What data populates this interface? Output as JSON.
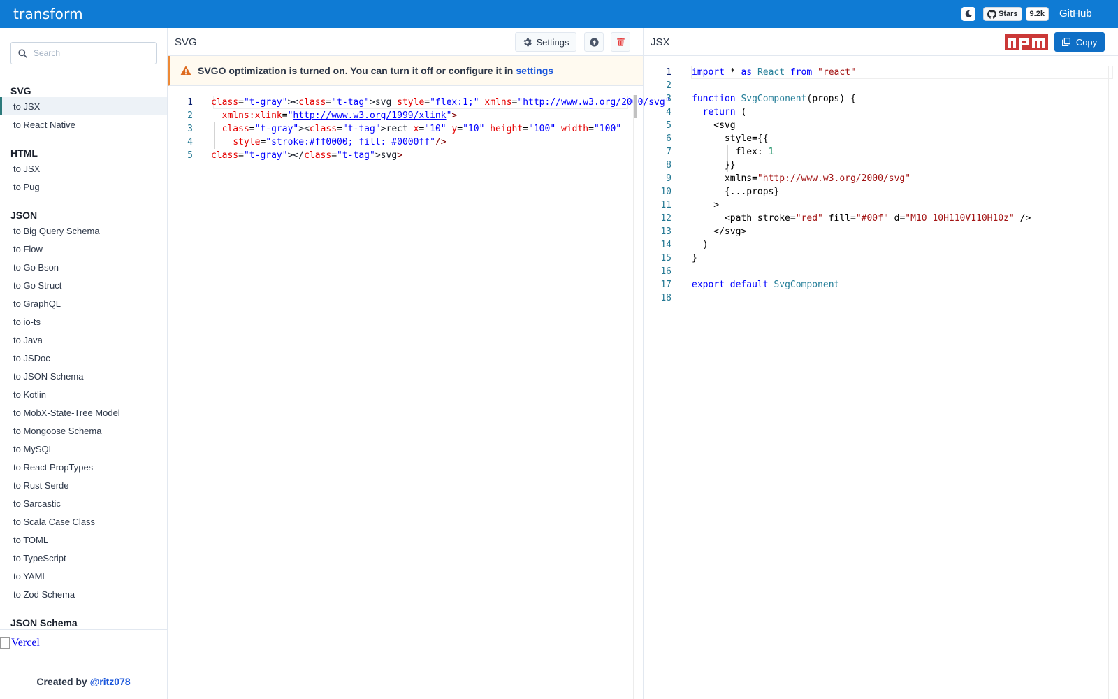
{
  "header": {
    "logo": "transform",
    "stars_label": "Stars",
    "stars_count": "9.2k",
    "github_link": "GitHub"
  },
  "sidebar": {
    "search_placeholder": "Search",
    "groups": [
      {
        "title": "SVG",
        "items": [
          "to JSX",
          "to React Native"
        ]
      },
      {
        "title": "HTML",
        "items": [
          "to JSX",
          "to Pug"
        ]
      },
      {
        "title": "JSON",
        "items": [
          "to Big Query Schema",
          "to Flow",
          "to Go Bson",
          "to Go Struct",
          "to GraphQL",
          "to io-ts",
          "to Java",
          "to JSDoc",
          "to JSON Schema",
          "to Kotlin",
          "to MobX-State-Tree Model",
          "to Mongoose Schema",
          "to MySQL",
          "to React PropTypes",
          "to Rust Serde",
          "to Sarcastic",
          "to Scala Case Class",
          "to TOML",
          "to TypeScript",
          "to YAML",
          "to Zod Schema"
        ]
      },
      {
        "title": "JSON Schema",
        "items": []
      }
    ],
    "vercel_alt": "Vercel",
    "created_by": "Created by",
    "author": "@ritz078"
  },
  "left_panel": {
    "title": "SVG",
    "settings_label": "Settings",
    "alert_text": "SVGO optimization is turned on. You can turn it off or configure it in",
    "alert_link": "settings",
    "line_numbers": [
      "1",
      "2",
      "3",
      "4",
      "5"
    ],
    "code_lines": [
      "<svg style=\"flex:1;\" xmlns=\"http://www.w3.org/2000/svg\"",
      "  xmlns:xlink=\"http://www.w3.org/1999/xlink\">",
      "  <rect x=\"10\" y=\"10\" height=\"100\" width=\"100\"",
      "    style=\"stroke:#ff0000; fill: #0000ff\"/>",
      "</svg>"
    ]
  },
  "right_panel": {
    "title": "JSX",
    "npm_label": "npm",
    "copy_label": "Copy",
    "line_numbers": [
      "1",
      "2",
      "3",
      "4",
      "5",
      "6",
      "7",
      "8",
      "9",
      "10",
      "11",
      "12",
      "13",
      "14",
      "15",
      "16",
      "17",
      "18"
    ],
    "code_lines": [
      "import * as React from \"react\"",
      "",
      "function SvgComponent(props) {",
      "  return (",
      "    <svg",
      "      style={{",
      "        flex: 1",
      "      }}",
      "      xmlns=\"http://www.w3.org/2000/svg\"",
      "      {...props}",
      "    >",
      "      <path stroke=\"red\" fill=\"#00f\" d=\"M10 10H110V110H10z\" />",
      "    </svg>",
      "  )",
      "}",
      "",
      "export default SvgComponent",
      ""
    ]
  },
  "colors": {
    "header_bg": "#0f7bd4",
    "copy_btn": "#0f6fc6",
    "npm_red": "#cb3837",
    "delete_red": "#e53e3e",
    "alert_bg": "#fffaf0",
    "alert_icon": "#dd6b20",
    "active_marker": "#2c7a7b"
  },
  "icons": {
    "theme": "moon-icon",
    "github": "github-icon",
    "search": "search-icon",
    "settings": "gear-icon",
    "upload": "upload-icon",
    "delete": "trash-icon",
    "alert": "warning-icon",
    "copy": "copy-icon"
  }
}
